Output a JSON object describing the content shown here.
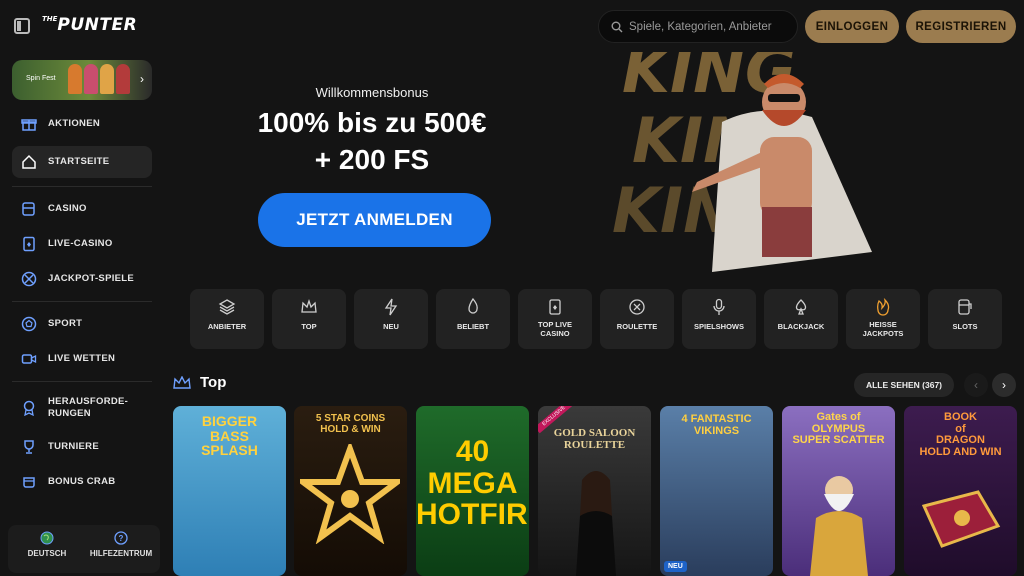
{
  "header": {
    "logo_prefix": "THE",
    "logo_text": "PUNTER",
    "search_placeholder": "Spiele, Kategorien, Anbieter",
    "login_label": "EINLOGGEN",
    "register_label": "REGISTRIEREN"
  },
  "sidebar": {
    "promo_label": "Spin Fest",
    "items": [
      {
        "label": "AKTIONEN",
        "icon": "gift-icon"
      },
      {
        "label": "STARTSEITE",
        "icon": "home-icon",
        "active": true
      },
      {
        "label": "CASINO",
        "icon": "slot-machine-icon"
      },
      {
        "label": "LIVE-CASINO",
        "icon": "card-icon"
      },
      {
        "label": "JACKPOT-SPIELE",
        "icon": "chip-icon"
      },
      {
        "label": "SPORT",
        "icon": "ball-icon"
      },
      {
        "label": "LIVE WETTEN",
        "icon": "video-icon"
      },
      {
        "label": "HERAUSFORDE-\nRUNGEN",
        "icon": "medal-icon"
      },
      {
        "label": "TURNIERE",
        "icon": "trophy-icon"
      },
      {
        "label": "BONUS CRAB",
        "icon": "crab-icon"
      }
    ],
    "footer": {
      "language": "DEUTSCH",
      "help": "HILFEZENTRUM"
    }
  },
  "hero": {
    "subtitle": "Willkommensbonus",
    "line1": "100% bis zu 500€",
    "line2": "+ 200 FS",
    "cta": "JETZT ANMELDEN",
    "art_text": "KING"
  },
  "categories": [
    {
      "label": "ANBIETER",
      "icon": "layers-icon"
    },
    {
      "label": "TOP",
      "icon": "crown-icon"
    },
    {
      "label": "NEU",
      "icon": "bolt-icon"
    },
    {
      "label": "BELIEBT",
      "icon": "flame-icon"
    },
    {
      "label": "TOP LIVE\nCASINO",
      "icon": "live-card-icon"
    },
    {
      "label": "ROULETTE",
      "icon": "roulette-icon"
    },
    {
      "label": "SPIELSHOWS",
      "icon": "microphone-icon"
    },
    {
      "label": "BLACKJACK",
      "icon": "spade-icon"
    },
    {
      "label": "HEISSE\nJACKPOTS",
      "icon": "hot-jackpot-icon"
    },
    {
      "label": "SLOTS",
      "icon": "slots-icon"
    }
  ],
  "top_section": {
    "title": "Top",
    "see_all": "ALLE SEHEN (367)",
    "games": [
      {
        "title": "BIGGER\nBASS\nSPLASH",
        "colors": [
          "#5fb0d8",
          "#2e7fb5"
        ],
        "text_color": "#ffd23f"
      },
      {
        "title": "5 STAR COINS\nHOLD & WIN",
        "colors": [
          "#2a1d10",
          "#140c05"
        ],
        "text_color": "#f2c14e"
      },
      {
        "title": "40\nMEGA\nHOTFIRE",
        "colors": [
          "#1f6b2a",
          "#0b3d14"
        ],
        "text_color": "#ffcc00"
      },
      {
        "title": "GOLD SALOON\nROULETTE",
        "colors": [
          "#3a3a3a",
          "#151515"
        ],
        "text_color": "#e8d39a",
        "badge": "EXCLUSIVE"
      },
      {
        "title": "4 FANTASTIC\nVIKINGS",
        "colors": [
          "#5a7fa8",
          "#2a3d5c"
        ],
        "text_color": "#ffcf40",
        "badge_new": "NEU"
      },
      {
        "title": "Gates of\nOLYMPUS\nSUPER SCATTER",
        "colors": [
          "#8b6fc0",
          "#4b2e7a"
        ],
        "text_color": "#ffd54a"
      },
      {
        "title": "BOOK\nof\nDRAGON\nHOLD AND WIN",
        "colors": [
          "#3d1c4f",
          "#1f0c2a"
        ],
        "text_color": "#ff9a3c"
      }
    ]
  },
  "colors": {
    "accent_gold": "#9b7c4f",
    "cta_blue": "#1a73e8",
    "tile_bg": "#222222"
  }
}
